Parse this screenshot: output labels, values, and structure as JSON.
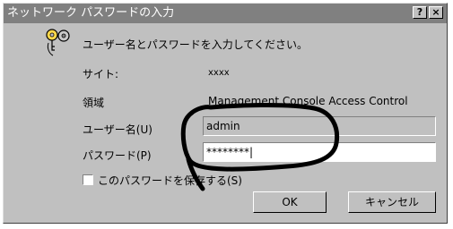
{
  "window": {
    "title": "ネットワーク パスワードの入力",
    "help_label": "?",
    "close_label": "×"
  },
  "dialog": {
    "prompt": "ユーザー名とパスワードを入力してください。",
    "site_label": "サイト:",
    "site_value": "xxxx",
    "realm_label": "領域",
    "realm_value": "Management Console Access Control",
    "username_label": "ユーザー名(U)",
    "username_value": "admin",
    "password_label": "パスワード(P)",
    "password_value": "********|",
    "save_password_label": "このパスワードを保存する(S)",
    "save_password_checked": false,
    "ok_label": "OK",
    "cancel_label": "キャンセル"
  },
  "icons": {
    "prompt_icon": "keys-icon"
  }
}
